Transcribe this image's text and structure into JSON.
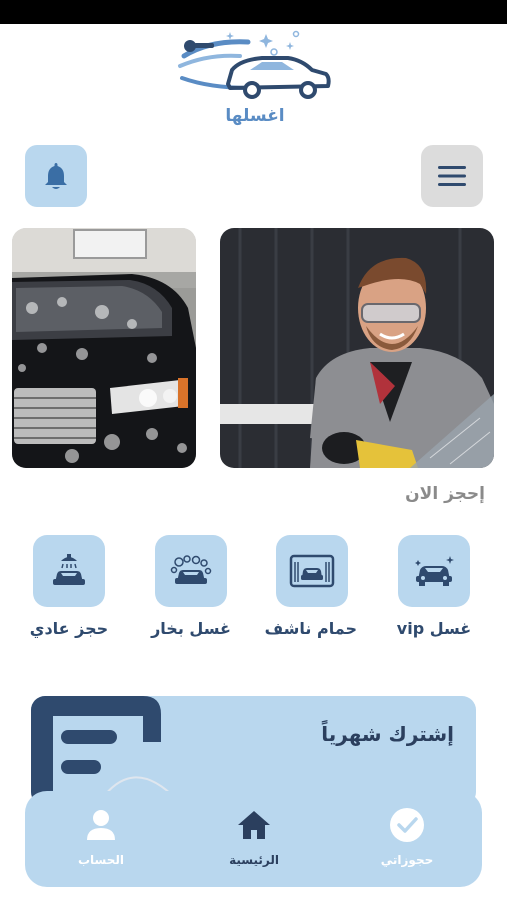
{
  "app": {
    "logo_text": "اغسلها"
  },
  "header": {
    "notifications_icon": "bell-icon",
    "menu_icon": "hamburger-menu-icon"
  },
  "banners": [
    {
      "subject": "foamed-black-car"
    },
    {
      "subject": "smiling-car-washer"
    }
  ],
  "booking": {
    "section_title": "إحجز الان",
    "services": [
      {
        "label": "غسل vip",
        "icon": "car-sparkle-icon"
      },
      {
        "label": "حمام ناشف",
        "icon": "car-wash-bay-icon"
      },
      {
        "label": "غسل بخار",
        "icon": "car-steam-icon"
      },
      {
        "label": "حجز عادي",
        "icon": "car-shower-icon"
      }
    ]
  },
  "subscription": {
    "title": "إشترك شهرياً"
  },
  "bottom_nav": {
    "items": [
      {
        "label": "حجوزاتي",
        "icon": "check-circle-icon"
      },
      {
        "label": "الرئيسية",
        "icon": "home-icon"
      },
      {
        "label": "الحساب",
        "icon": "user-icon"
      }
    ],
    "active": "الرئيسية"
  },
  "colors": {
    "accent": "#b9d7ee",
    "primary_text": "#2f4a6e",
    "muted_text": "#8a8a8a",
    "logo_blue": "#5a8cc4"
  }
}
